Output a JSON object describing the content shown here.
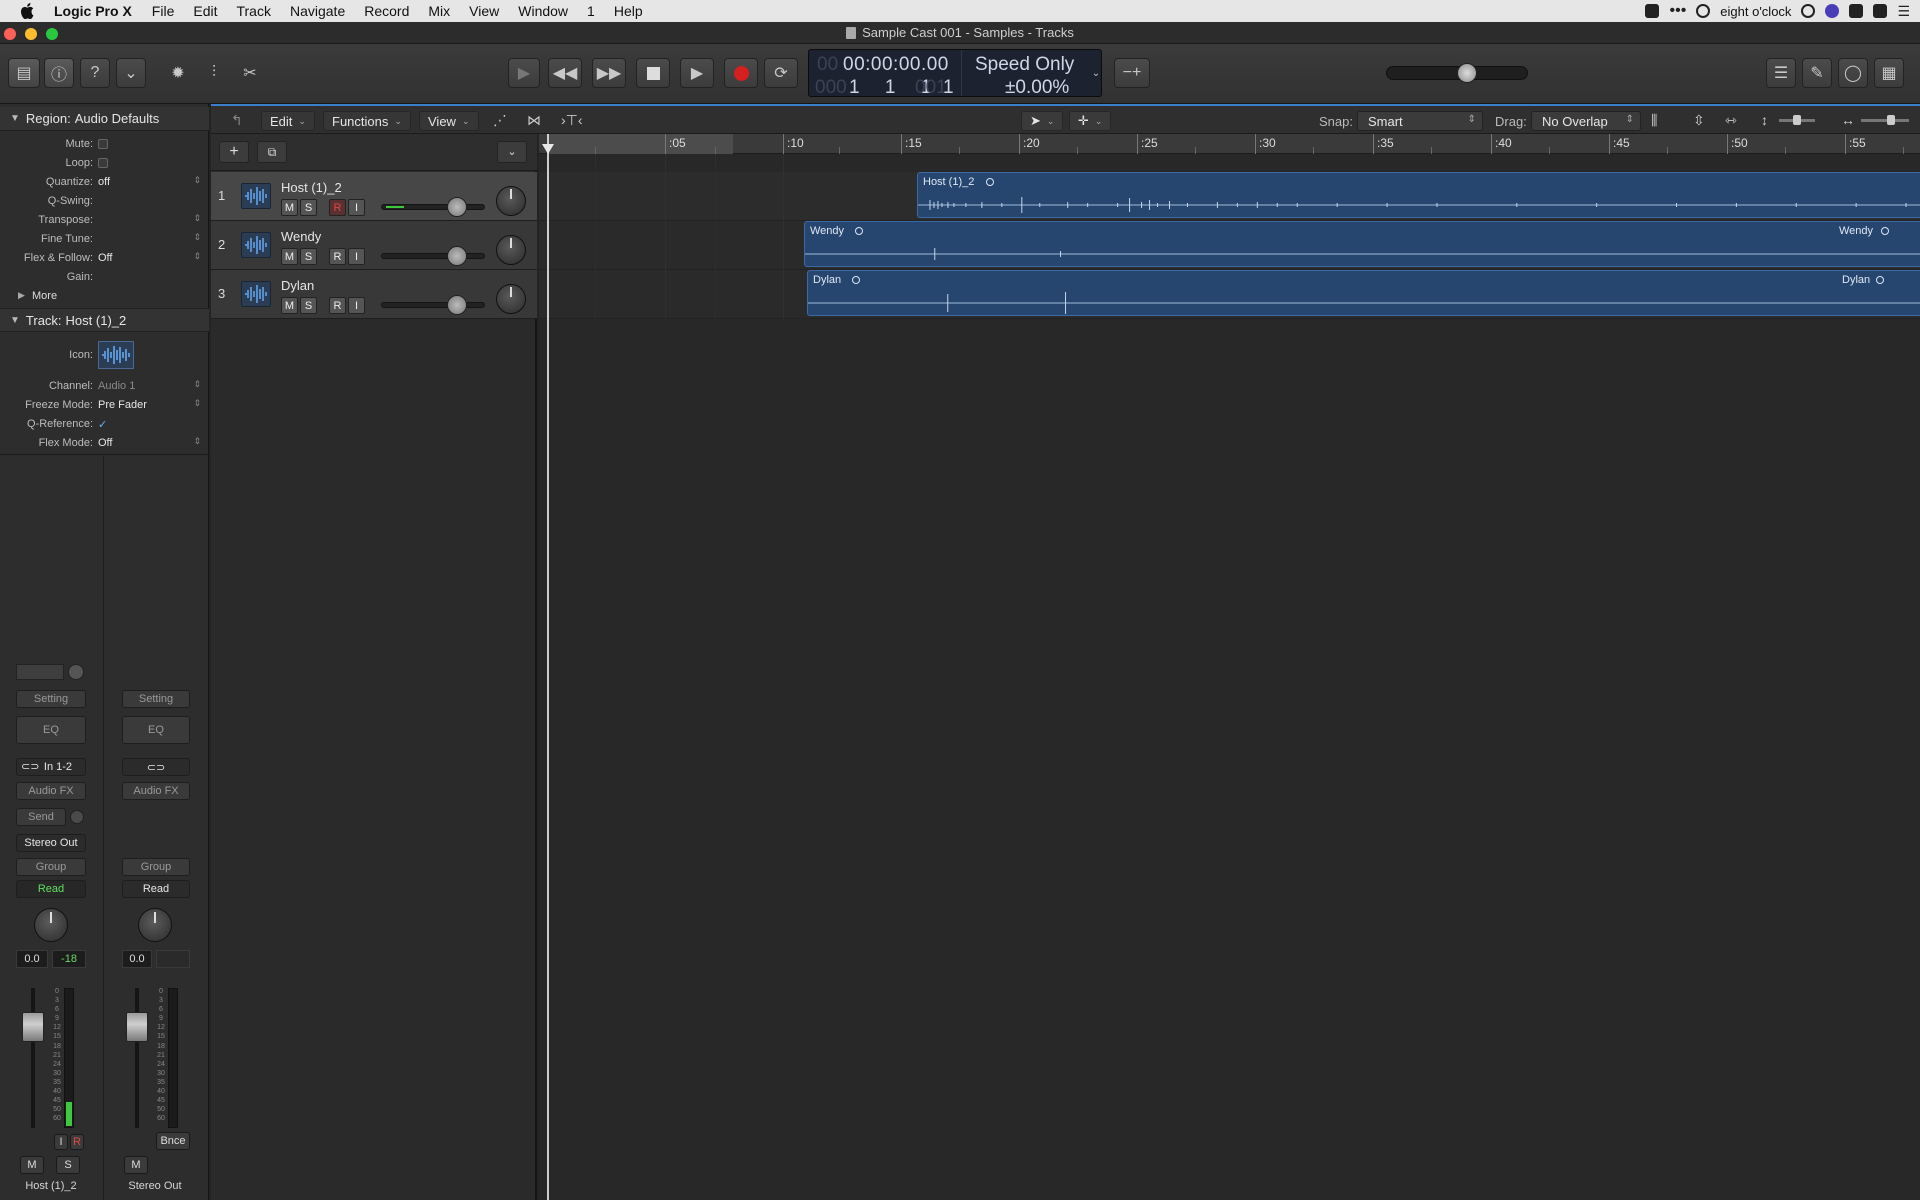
{
  "menubar": {
    "app_name": "Logic Pro X",
    "items": [
      "File",
      "Edit",
      "Track",
      "Navigate",
      "Record",
      "Mix",
      "View",
      "Window",
      "1",
      "Help"
    ],
    "clock": "eight o'clock"
  },
  "window": {
    "title": "Sample Cast 001 - Samples - Tracks"
  },
  "lcd": {
    "timecode": "00:00:00.00",
    "timecode_prefix": "00",
    "bars": "1 1 1",
    "bars_prefix": "000",
    "ticks_prefix": "001",
    "ticks": "1",
    "mode": "Speed Only",
    "tempo_pct": "±0.00%"
  },
  "inspector": {
    "region_header": "Region:",
    "region_name": "Audio Defaults",
    "region_rows": [
      {
        "label": "Mute:",
        "value": ""
      },
      {
        "label": "Loop:",
        "value": ""
      },
      {
        "label": "Quantize:",
        "value": "off"
      },
      {
        "label": "Q-Swing:",
        "value": ""
      },
      {
        "label": "Transpose:",
        "value": ""
      },
      {
        "label": "Fine Tune:",
        "value": ""
      },
      {
        "label": "Flex & Follow:",
        "value": "Off"
      },
      {
        "label": "Gain:",
        "value": ""
      }
    ],
    "more_label": "More",
    "track_header": "Track:",
    "track_name": "Host (1)_2",
    "track_rows": [
      {
        "label": "Icon:",
        "value": ""
      },
      {
        "label": "Channel:",
        "value": "Audio 1"
      },
      {
        "label": "Freeze Mode:",
        "value": "Pre Fader"
      },
      {
        "label": "Q-Reference:",
        "value": "✓"
      },
      {
        "label": "Flex Mode:",
        "value": "Off"
      }
    ]
  },
  "strips": {
    "left": {
      "setting": "Setting",
      "eq": "EQ",
      "input": "In 1-2",
      "audio_fx": "Audio FX",
      "send": "Send",
      "output": "Stereo Out",
      "group": "Group",
      "automation": "Read",
      "volume": "0.0",
      "peak": "-18",
      "mute": "M",
      "solo": "S",
      "input_mon": "I",
      "rec": "R",
      "name": "Host (1)_2"
    },
    "right": {
      "setting": "Setting",
      "eq": "EQ",
      "audio_fx": "Audio FX",
      "group": "Group",
      "automation": "Read",
      "volume": "0.0",
      "mute": "M",
      "bounce": "Bnce",
      "name": "Stereo Out"
    },
    "scale": [
      "0",
      "3",
      "6",
      "9",
      "12",
      "15",
      "18",
      "21",
      "24",
      "30",
      "35",
      "40",
      "45",
      "50",
      "60"
    ]
  },
  "tracks_header": {
    "edit": "Edit",
    "functions": "Functions",
    "view": "View",
    "snap_label": "Snap:",
    "snap_value": "Smart",
    "drag_label": "Drag:",
    "drag_value": "No Overlap"
  },
  "ruler": [
    ":05",
    ":10",
    ":15",
    ":20",
    ":25",
    ":30",
    ":35",
    ":40",
    ":45",
    ":50",
    ":55"
  ],
  "tracks": [
    {
      "num": "1",
      "name": "Host (1)_2",
      "m": "M",
      "s": "S",
      "r": "R",
      "i": "I"
    },
    {
      "num": "2",
      "name": "Wendy",
      "m": "M",
      "s": "S",
      "r": "R",
      "i": "I"
    },
    {
      "num": "3",
      "name": "Dylan",
      "m": "M",
      "s": "S",
      "r": "R",
      "i": "I"
    }
  ],
  "regions": [
    {
      "name": "Host (1)_2",
      "end_name": ""
    },
    {
      "name": "Wendy",
      "end_name": "Wendy"
    },
    {
      "name": "Dylan",
      "end_name": "Dylan"
    }
  ],
  "colors": {
    "accent": "#3a7fc8",
    "region": "#26466f",
    "record": "#d42020"
  }
}
